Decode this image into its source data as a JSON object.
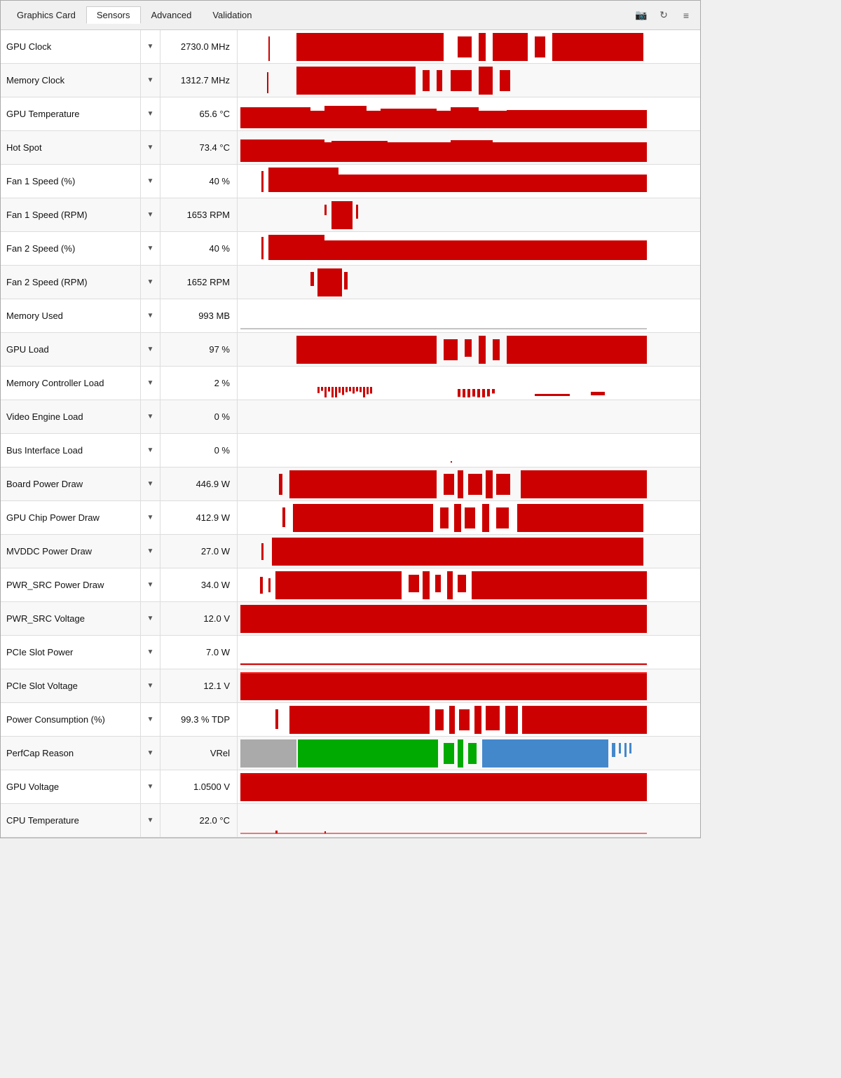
{
  "tabs": [
    {
      "label": "Graphics Card",
      "active": false
    },
    {
      "label": "Sensors",
      "active": true
    },
    {
      "label": "Advanced",
      "active": false
    },
    {
      "label": "Validation",
      "active": false
    }
  ],
  "icons": {
    "camera": "📷",
    "refresh": "↻",
    "menu": "≡"
  },
  "sensors": [
    {
      "name": "GPU Clock",
      "value": "2730.0 MHz",
      "graph_type": "clock_gpu"
    },
    {
      "name": "Memory Clock",
      "value": "1312.7 MHz",
      "graph_type": "clock_mem"
    },
    {
      "name": "GPU Temperature",
      "value": "65.6 °C",
      "graph_type": "temp_gpu"
    },
    {
      "name": "Hot Spot",
      "value": "73.4 °C",
      "graph_type": "temp_hotspot"
    },
    {
      "name": "Fan 1 Speed (%)",
      "value": "40 %",
      "graph_type": "fan1_pct"
    },
    {
      "name": "Fan 1 Speed (RPM)",
      "value": "1653 RPM",
      "graph_type": "fan1_rpm"
    },
    {
      "name": "Fan 2 Speed (%)",
      "value": "40 %",
      "graph_type": "fan2_pct"
    },
    {
      "name": "Fan 2 Speed (RPM)",
      "value": "1652 RPM",
      "graph_type": "fan2_rpm"
    },
    {
      "name": "Memory Used",
      "value": "993 MB",
      "graph_type": "mem_used"
    },
    {
      "name": "GPU Load",
      "value": "97 %",
      "graph_type": "gpu_load"
    },
    {
      "name": "Memory Controller Load",
      "value": "2 %",
      "graph_type": "mem_ctrl"
    },
    {
      "name": "Video Engine Load",
      "value": "0 %",
      "graph_type": "empty"
    },
    {
      "name": "Bus Interface Load",
      "value": "0 %",
      "graph_type": "bus_tiny"
    },
    {
      "name": "Board Power Draw",
      "value": "446.9 W",
      "graph_type": "power_board"
    },
    {
      "name": "GPU Chip Power Draw",
      "value": "412.9 W",
      "graph_type": "power_chip"
    },
    {
      "name": "MVDDC Power Draw",
      "value": "27.0 W",
      "graph_type": "mvddc"
    },
    {
      "name": "PWR_SRC Power Draw",
      "value": "34.0 W",
      "graph_type": "pwr_src"
    },
    {
      "name": "PWR_SRC Voltage",
      "value": "12.0 V",
      "graph_type": "voltage_full"
    },
    {
      "name": "PCIe Slot Power",
      "value": "7.0 W",
      "graph_type": "pcie_power"
    },
    {
      "name": "PCIe Slot Voltage",
      "value": "12.1 V",
      "graph_type": "pcie_voltage"
    },
    {
      "name": "Power Consumption (%)",
      "value": "99.3 % TDP",
      "graph_type": "power_pct"
    },
    {
      "name": "PerfCap Reason",
      "value": "VRel",
      "graph_type": "perfcap"
    },
    {
      "name": "GPU Voltage",
      "value": "1.0500 V",
      "graph_type": "gpu_voltage"
    },
    {
      "name": "CPU Temperature",
      "value": "22.0 °C",
      "graph_type": "cpu_temp"
    }
  ]
}
